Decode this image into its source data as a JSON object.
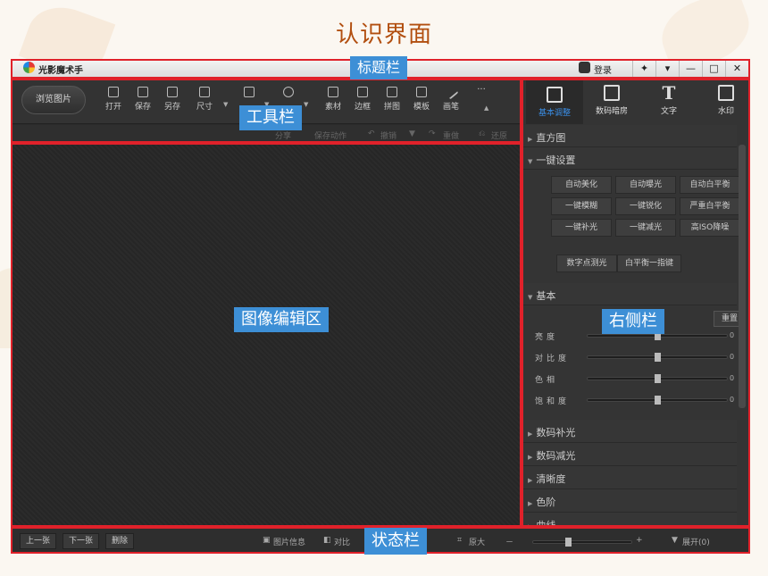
{
  "page": {
    "title": "认识界面"
  },
  "titlebar": {
    "app_name": "光影魔术手",
    "login": "登录",
    "controls": [
      "✦",
      "▾",
      "—",
      "□",
      "✕"
    ]
  },
  "toolbar": {
    "browse": "浏览图片",
    "tools": [
      "打开",
      "保存",
      "另存",
      "尺寸",
      "",
      "",
      "素材",
      "边框",
      "拼图",
      "模板",
      "画笔"
    ],
    "more": "···",
    "subtools": {
      "share": "分享",
      "save_action": "保存动作",
      "undo": "撤销",
      "redo": "重做",
      "restore": "还原"
    }
  },
  "sidebar": {
    "tabs": [
      "基本调整",
      "数码暗房",
      "文字",
      "水印"
    ],
    "sections_top": [
      "直方图",
      "一键设置"
    ],
    "quick_buttons": [
      [
        "自动美化",
        "自动曝光",
        "自动白平衡"
      ],
      [
        "一键模糊",
        "一键锐化",
        "严重白平衡"
      ],
      [
        "一键补光",
        "一键减光",
        "高ISO降噪"
      ]
    ],
    "extra_buttons": [
      "数字点测光",
      "白平衡一指键"
    ],
    "basic_section": "基本",
    "reset": "重置",
    "sliders": [
      {
        "label": "亮度",
        "value": "0",
        "level": 0.5
      },
      {
        "label": "对比度",
        "value": "0",
        "level": 0.5
      },
      {
        "label": "色相",
        "value": "0",
        "level": 0.5
      },
      {
        "label": "饱和度",
        "value": "0",
        "level": 0.5
      }
    ],
    "sections_bottom": [
      "数码补光",
      "数码减光",
      "清晰度",
      "色阶",
      "曲线"
    ]
  },
  "statusbar": {
    "prev": "上一张",
    "next": "下一张",
    "delete": "删除",
    "info": "图片信息",
    "compare": "对比",
    "original": "原大",
    "zoom_minus": "－",
    "zoom_plus": "+",
    "expand": "展开(0)",
    "zoom_level": 0.35
  },
  "annotations": {
    "titlebar": "标题栏",
    "toolbar": "工具栏",
    "editor": "图像编辑区",
    "sidebar": "右侧栏",
    "statusbar": "状态栏"
  },
  "colors": {
    "accent": "#3a8ee6",
    "callout": "#3d8fd6",
    "frame": "#e0212a",
    "title": "#b24f10"
  }
}
